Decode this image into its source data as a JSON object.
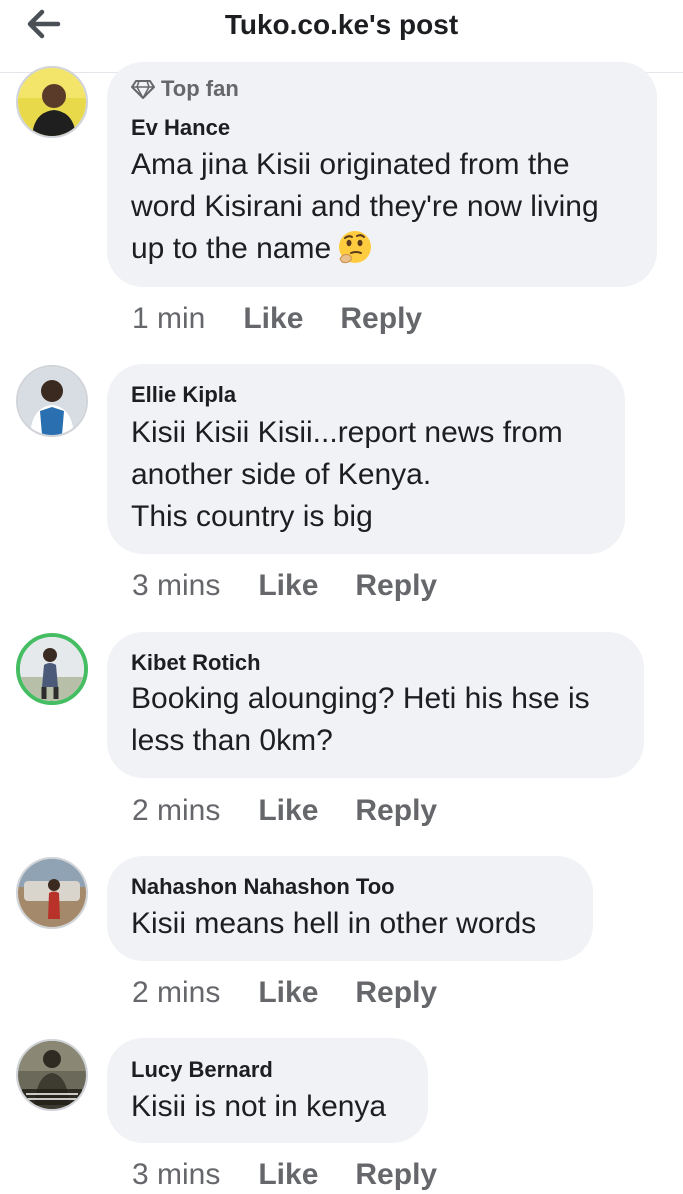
{
  "header": {
    "title": "Tuko.co.ke's post"
  },
  "comments": [
    {
      "badge": "Top fan",
      "author": "Ev Hance",
      "lines": [
        "Ama jina Kisii originated from the",
        "word Kisirani and they're now living",
        "up to the name"
      ],
      "time": "1 min",
      "like": "Like",
      "reply": "Reply"
    },
    {
      "author": "Ellie Kipla",
      "lines": [
        "Kisii Kisii Kisii...report news from",
        "another side of Kenya.",
        "This country is big"
      ],
      "time": "3 mins",
      "like": "Like",
      "reply": "Reply"
    },
    {
      "author": "Kibet Rotich",
      "lines": [
        "Booking alounging? Heti his hse is",
        "less than 0km?"
      ],
      "time": "2 mins",
      "like": "Like",
      "reply": "Reply"
    },
    {
      "author": "Nahashon Nahashon Too",
      "lines": [
        "Kisii means hell in other words"
      ],
      "time": "2 mins",
      "like": "Like",
      "reply": "Reply"
    },
    {
      "author": "Lucy Bernard",
      "lines": [
        "Kisii is not in kenya"
      ],
      "time": "3 mins",
      "like": "Like",
      "reply": "Reply"
    }
  ],
  "colors": {
    "bubble": "#f0f2f5",
    "meta": "#65676b",
    "text": "#1c1e21",
    "ring": "#45bd62"
  },
  "icons": {
    "back": "arrow-left-icon",
    "badge": "diamond-icon",
    "emoji": "thinking-face-icon"
  }
}
